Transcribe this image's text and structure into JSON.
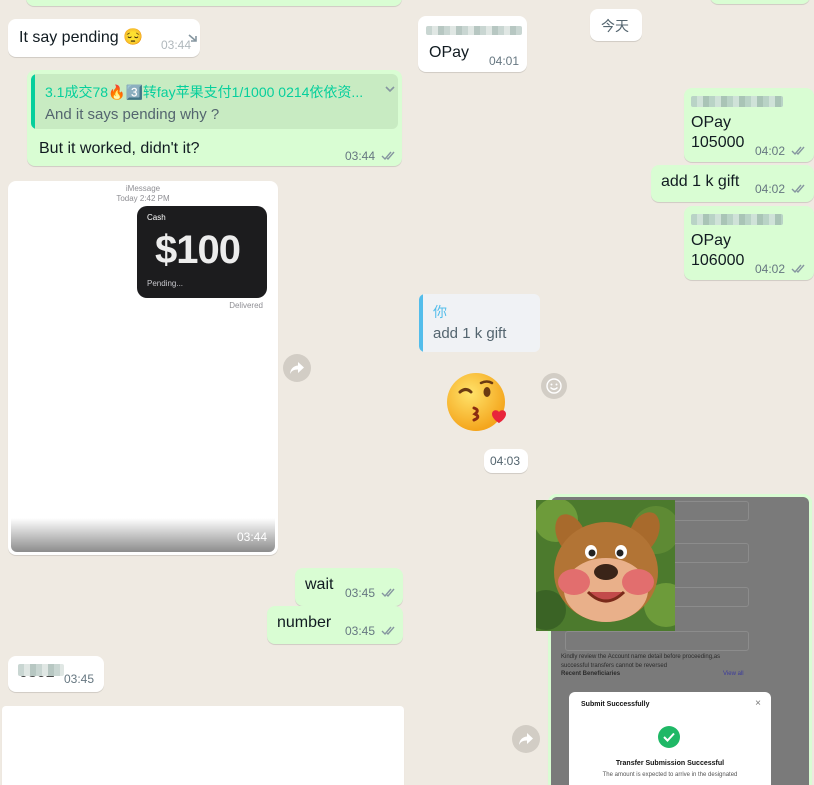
{
  "left": {
    "msg1": {
      "text": "It say pending 😔",
      "time": "03:44"
    },
    "reply": {
      "quoted_header": "3.1成交78🔥3️⃣转fay苹果支付1/1000 0214依依资...",
      "quoted_text": "And it says pending why ?",
      "text": "But it worked, didn't it?",
      "time": "03:44"
    },
    "image_msg": {
      "imessage_label": "iMessage",
      "imessage_time": "Today 2:42 PM",
      "cash_label": "Cash",
      "amount": "$100",
      "status": "Pending...",
      "delivered": "Delivered",
      "time": "03:44"
    },
    "wait": {
      "text": "wait",
      "time": "03:45"
    },
    "number": {
      "text": "number",
      "time": "03:45"
    },
    "redacted_msg": {
      "text": "0302",
      "time": "03:45"
    }
  },
  "right": {
    "opay_in": {
      "text": "OPay",
      "time": "04:01"
    },
    "date_chip": "今天",
    "opay1": {
      "line1": "OPay",
      "line2": "105000",
      "time": "04:02"
    },
    "gift": {
      "text": "add 1 k gift",
      "time": "04:02"
    },
    "opay2": {
      "line1": "OPay",
      "line2": "106000",
      "time": "04:02"
    },
    "quote_in": {
      "author": "你",
      "text": "add 1 k gift"
    },
    "sticker_time": "04:03",
    "receipt": {
      "notice": "Kindly review the Account name detail before proceeding,as successful transfers cannot be reversed",
      "recent_label": "Recent Beneficiaries",
      "view_all": "View all",
      "modal_title": "Submit Successfully",
      "modal_heading": "Transfer Submission Successful",
      "modal_text": "The amount is expected to arrive in the designated"
    }
  },
  "colors": {
    "outgoing": "#d9fdd3",
    "incoming": "#ffffff",
    "background": "#efeae2",
    "tick": "#53bdeb",
    "accent": "#06cf9c"
  }
}
